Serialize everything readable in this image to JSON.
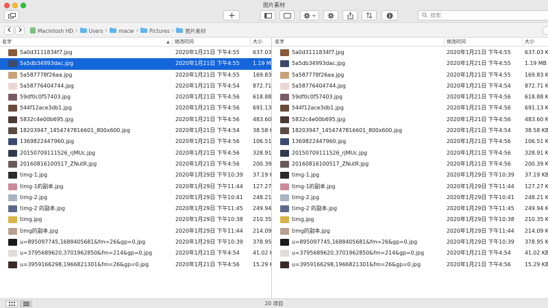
{
  "window": {
    "title": "图片素材"
  },
  "toolbar": {
    "search_placeholder": "搜索",
    "icons": [
      "tab-overview-icon",
      "new-tab-icon",
      "sidebar-icon",
      "view-mode-icon",
      "action-gear-icon",
      "settings-gear-icon",
      "share-icon",
      "sort-icon",
      "info-icon",
      "search-icon"
    ]
  },
  "pathbar": {
    "crumbs": [
      {
        "label": "Macintosh HD",
        "icon": "drive-icon"
      },
      {
        "label": "Users",
        "icon": "folder-icon"
      },
      {
        "label": "macw",
        "icon": "folder-icon"
      },
      {
        "label": "Pictures",
        "icon": "folder-icon"
      },
      {
        "label": "图片素材",
        "icon": "folder-icon"
      }
    ]
  },
  "columns": {
    "name": "名字",
    "modified": "修改时间",
    "size": "大小"
  },
  "colors": {
    "selection": "#1565db"
  },
  "left_pane": {
    "selected_index": 1,
    "files": [
      {
        "name": "5a0d3111834f7.jpg",
        "modified": "2020年1月21日 下午4:55",
        "size": "637.03",
        "thumb": "#8a5a3c"
      },
      {
        "name": "5a5db34993dac.jpg",
        "modified": "2020年1月21日 下午4:55",
        "size": "1.19 MB",
        "thumb": "#3a4a6a"
      },
      {
        "name": "5a587778f26aa.jpg",
        "modified": "2020年1月21日 下午4:55",
        "size": "169.83",
        "thumb": "#c9a27a"
      },
      {
        "name": "5a58776404744.jpg",
        "modified": "2020年1月21日 下午4:54",
        "size": "872.71",
        "thumb": "#e8d7d2"
      },
      {
        "name": "59df0c0f57403.jpg",
        "modified": "2020年1月21日 下午4:56",
        "size": "618.88",
        "thumb": "#7a5a66"
      },
      {
        "name": "544f12ace3db1.jpg",
        "modified": "2020年1月21日 下午4:56",
        "size": "691.13",
        "thumb": "#6b4a3a"
      },
      {
        "name": "5832c4e00b695.jpg",
        "modified": "2020年1月21日 下午4:56",
        "size": "483.60",
        "thumb": "#4a3a33"
      },
      {
        "name": "18203947_1454747816601_800x600.jpg",
        "modified": "2020年1月21日 下午4:54",
        "size": "38.58 K",
        "thumb": "#5a4a42"
      },
      {
        "name": "1369822447960.jpg",
        "modified": "2020年1月21日 下午4:56",
        "size": "106.51",
        "thumb": "#3b4b72"
      },
      {
        "name": "20150709111526_rjMUc.jpg",
        "modified": "2020年1月21日 下午4:56",
        "size": "328.91",
        "thumb": "#2f3a4a"
      },
      {
        "name": "20160816100517_ZNutR.jpg",
        "modified": "2020年1月21日 下午4:56",
        "size": "200.39",
        "thumb": "#6a5a5a"
      },
      {
        "name": "timg-1.jpg",
        "modified": "2020年1月29日 下午10:39",
        "size": "37.19 K",
        "thumb": "#2a2a2a"
      },
      {
        "name": "timg-1的副本.jpg",
        "modified": "2020年1月29日 下午11:44",
        "size": "127.27",
        "thumb": "#c98a9a"
      },
      {
        "name": "timg-2.jpg",
        "modified": "2020年1月29日 下午10:41",
        "size": "248.21",
        "thumb": "#a8b4c0"
      },
      {
        "name": "timg-2 的副本.jpg",
        "modified": "2020年1月29日 下午11:45",
        "size": "249.94",
        "thumb": "#5a6a8a"
      },
      {
        "name": "timg.jpg",
        "modified": "2020年1月29日 下午10:38",
        "size": "210.35",
        "thumb": "#d9b34a"
      },
      {
        "name": "timg的副本.jpg",
        "modified": "2020年1月29日 下午11:44",
        "size": "214.09",
        "thumb": "#b8a090"
      },
      {
        "name": "u=895097745,1688405681&fm=26&gp=0.jpg",
        "modified": "2020年1月29日 下午10:39",
        "size": "378.95",
        "thumb": "#1a1a1a"
      },
      {
        "name": "u=3795689620,3701962850&fm=214&gp=0.jpg",
        "modified": "2020年1月21日 下午4:54",
        "size": "41.02 K",
        "thumb": "#e0ddd8"
      },
      {
        "name": "u=3959166298,1966821301&fm=26&gp=0.jpg",
        "modified": "2020年1月21日 下午4:56",
        "size": "15.29 K",
        "thumb": "#3a2a2a"
      }
    ]
  },
  "right_pane": {
    "selected_index": -1,
    "files": [
      {
        "name": "5a0d3111834f7.jpg",
        "modified": "2020年1月21日 下午4:55",
        "size": "637.03 K",
        "thumb": "#8a5a3c"
      },
      {
        "name": "5a5db34993dac.jpg",
        "modified": "2020年1月21日 下午4:55",
        "size": "1.19 MB",
        "thumb": "#3a4a6a"
      },
      {
        "name": "5a587778f26aa.jpg",
        "modified": "2020年1月21日 下午4:55",
        "size": "169.83 K",
        "thumb": "#c9a27a"
      },
      {
        "name": "5a58776404744.jpg",
        "modified": "2020年1月21日 下午4:54",
        "size": "872.71 K",
        "thumb": "#e8d7d2"
      },
      {
        "name": "59df0c0f57403.jpg",
        "modified": "2020年1月21日 下午4:56",
        "size": "618.88 K",
        "thumb": "#7a5a66"
      },
      {
        "name": "544f12ace3db1.jpg",
        "modified": "2020年1月21日 下午4:56",
        "size": "691.13 K",
        "thumb": "#6b4a3a"
      },
      {
        "name": "5832c4e00b695.jpg",
        "modified": "2020年1月21日 下午4:56",
        "size": "483.60 K",
        "thumb": "#4a3a33"
      },
      {
        "name": "18203947_1454747816601_800x600.jpg",
        "modified": "2020年1月21日 下午4:54",
        "size": "38.58 KB",
        "thumb": "#5a4a42"
      },
      {
        "name": "1369822447960.jpg",
        "modified": "2020年1月21日 下午4:56",
        "size": "106.51 K",
        "thumb": "#3b4b72"
      },
      {
        "name": "20150709111526_rjMUc.jpg",
        "modified": "2020年1月21日 下午4:56",
        "size": "328.91 K",
        "thumb": "#2f3a4a"
      },
      {
        "name": "20160816100517_ZNutR.jpg",
        "modified": "2020年1月21日 下午4:56",
        "size": "200.39 K",
        "thumb": "#6a5a5a"
      },
      {
        "name": "timg-1.jpg",
        "modified": "2020年1月29日 下午10:39",
        "size": "37.19 KB",
        "thumb": "#2a2a2a"
      },
      {
        "name": "timg-1的副本.jpg",
        "modified": "2020年1月29日 下午11:44",
        "size": "127.27 K",
        "thumb": "#c98a9a"
      },
      {
        "name": "timg-2.jpg",
        "modified": "2020年1月29日 下午10:41",
        "size": "248.21 K",
        "thumb": "#a8b4c0"
      },
      {
        "name": "timg-2 的副本.jpg",
        "modified": "2020年1月29日 下午11:45",
        "size": "249.94 K",
        "thumb": "#5a6a8a"
      },
      {
        "name": "timg.jpg",
        "modified": "2020年1月29日 下午10:38",
        "size": "210.35 K",
        "thumb": "#d9b34a"
      },
      {
        "name": "timg的副本.jpg",
        "modified": "2020年1月29日 下午11:44",
        "size": "214.09 K",
        "thumb": "#b8a090"
      },
      {
        "name": "u=895097745,1688405681&fm=26&gp=0.jpg",
        "modified": "2020年1月29日 下午10:39",
        "size": "378.95 K",
        "thumb": "#1a1a1a"
      },
      {
        "name": "u=3795689620,3701962850&fm=214&gp=0.jpg",
        "modified": "2020年1月21日 下午4:54",
        "size": "41.02 KB",
        "thumb": "#e0ddd8"
      },
      {
        "name": "u=3959166298,1966821301&fm=26&gp=0.jpg",
        "modified": "2020年1月21日 下午4:56",
        "size": "15.29 KB",
        "thumb": "#3a2a2a"
      }
    ]
  },
  "status": {
    "text": "20 项目"
  }
}
